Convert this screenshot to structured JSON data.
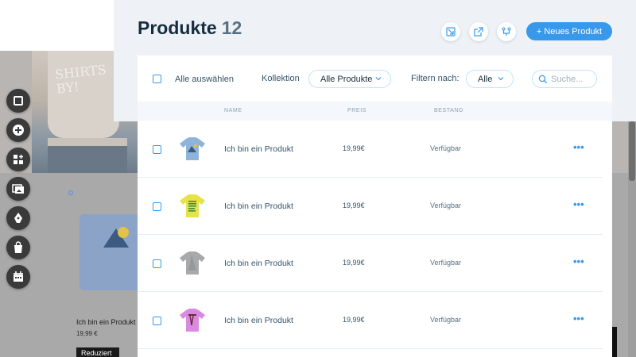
{
  "header": {
    "title": "Produkte",
    "count": "12",
    "new_product_label": "+ Neues Produkt",
    "icons": [
      "import-icon",
      "export-icon",
      "arrange-icon"
    ]
  },
  "toolbar": {
    "select_all_label": "Alle auswählen",
    "collection_label": "Kollektion",
    "collection_value": "Alle Produkte",
    "filter_label": "Filtern nach:",
    "filter_value": "Alle",
    "search_placeholder": "Suche..."
  },
  "columns": {
    "name": "NAME",
    "price": "PREIS",
    "stock": "BESTAND"
  },
  "products": [
    {
      "name": "Ich bin ein Produkt",
      "price": "19,99€",
      "stock": "Verfügbar",
      "thumb_color": "#8fb4d9",
      "thumb_icon": "shirt-blue-icon"
    },
    {
      "name": "Ich bin ein Produkt",
      "price": "19,99€",
      "stock": "Verfügbar",
      "thumb_color": "#e8e24a",
      "thumb_icon": "shirt-yellow-icon"
    },
    {
      "name": "Ich bin ein Produkt",
      "price": "19,99€",
      "stock": "Verfügbar",
      "thumb_color": "#a7a9ab",
      "thumb_icon": "shirt-grey-icon"
    },
    {
      "name": "Ich bin ein Produkt",
      "price": "19,99€",
      "stock": "Verfügbar",
      "thumb_color": "#d98ae0",
      "thumb_icon": "shirt-pink-icon"
    }
  ],
  "background": {
    "shirt_text": "SHIRTS\nBY!",
    "product_name": "Ich bin ein Produkt",
    "product_price": "19,99 €",
    "badge": "Reduziert"
  },
  "tool_rail": [
    "layout-icon",
    "add-icon",
    "apps-icon",
    "media-icon",
    "pen-icon",
    "store-icon",
    "calendar-icon"
  ],
  "colors": {
    "accent": "#3899ec",
    "title": "#162d3d",
    "panel_bg": "#eef2f7"
  }
}
